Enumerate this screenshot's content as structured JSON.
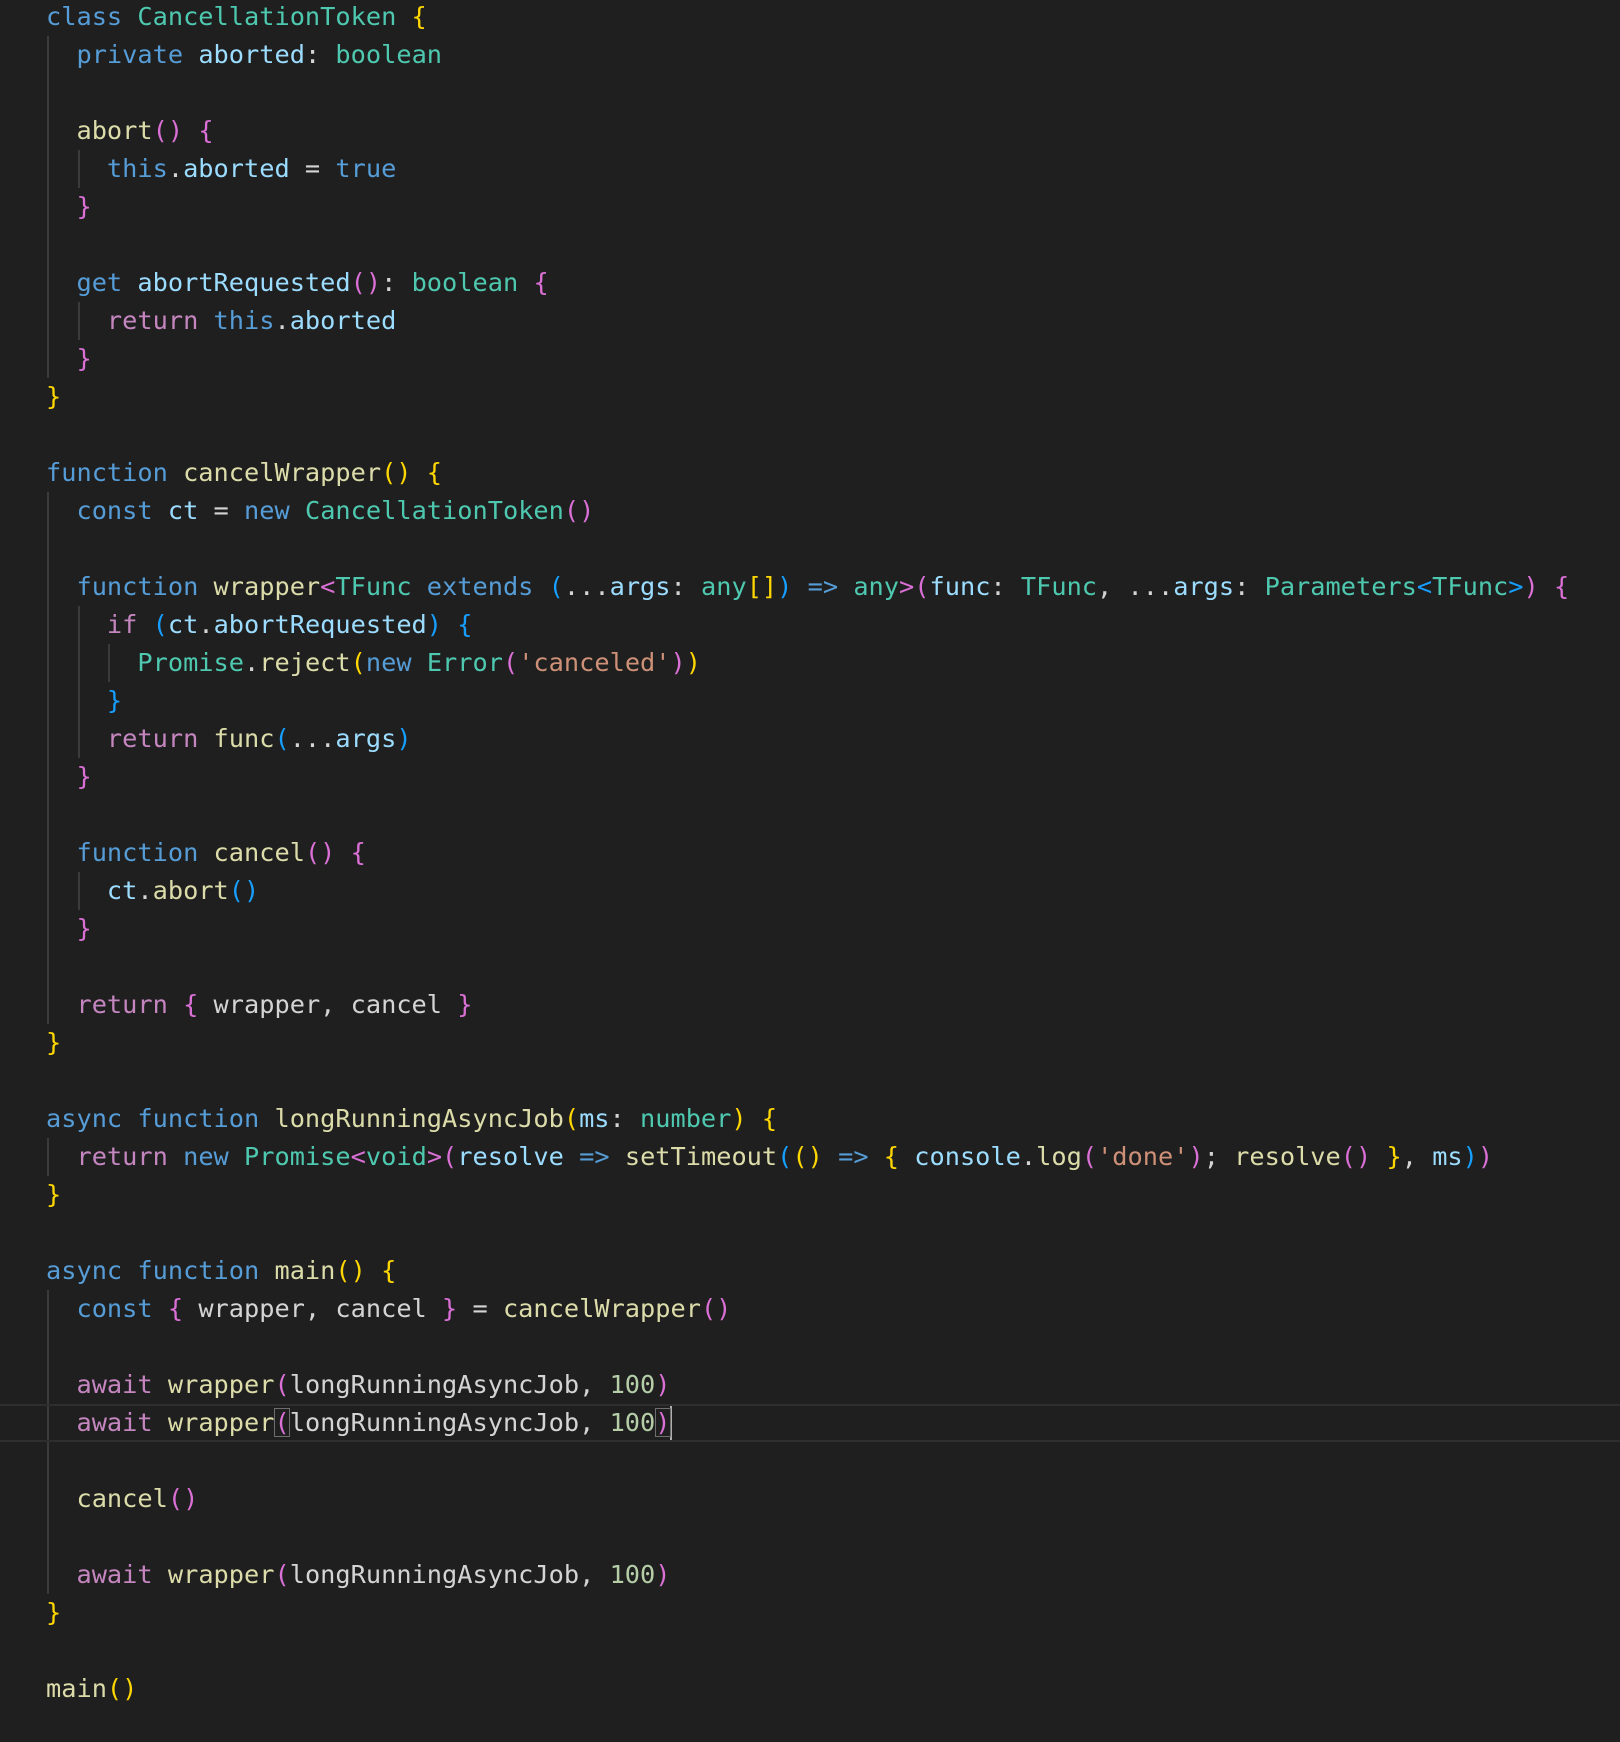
{
  "editor": {
    "language": "typescript",
    "theme_colors": {
      "background": "#1f1f1f",
      "keyword": "#569cd6",
      "control": "#c586c0",
      "type": "#4ec9b0",
      "function": "#dcdcaa",
      "variable": "#9cdcfe",
      "string": "#ce9178",
      "number": "#b5cea8",
      "bracket_level_1": "#ffd700",
      "bracket_level_2": "#da70d6",
      "bracket_level_3": "#179fff"
    },
    "cursor_line": 37,
    "lines": [
      [
        [
          "kw",
          "class"
        ],
        [
          "op",
          " "
        ],
        [
          "ty",
          "CancellationToken"
        ],
        [
          "op",
          " "
        ],
        [
          "b1",
          "{"
        ]
      ],
      [
        [
          "op",
          "  "
        ],
        [
          "kw",
          "private"
        ],
        [
          "op",
          " "
        ],
        [
          "var",
          "aborted"
        ],
        [
          "op",
          ": "
        ],
        [
          "ty",
          "boolean"
        ]
      ],
      [],
      [
        [
          "op",
          "  "
        ],
        [
          "fn",
          "abort"
        ],
        [
          "b2",
          "()"
        ],
        [
          "op",
          " "
        ],
        [
          "b2",
          "{"
        ]
      ],
      [
        [
          "op",
          "    "
        ],
        [
          "kw",
          "this"
        ],
        [
          "op",
          "."
        ],
        [
          "var",
          "aborted"
        ],
        [
          "op",
          " = "
        ],
        [
          "kw",
          "true"
        ]
      ],
      [
        [
          "op",
          "  "
        ],
        [
          "b2",
          "}"
        ]
      ],
      [],
      [
        [
          "op",
          "  "
        ],
        [
          "kw",
          "get"
        ],
        [
          "op",
          " "
        ],
        [
          "var",
          "abortRequested"
        ],
        [
          "b2",
          "()"
        ],
        [
          "op",
          ": "
        ],
        [
          "ty",
          "boolean"
        ],
        [
          "op",
          " "
        ],
        [
          "b2",
          "{"
        ]
      ],
      [
        [
          "op",
          "    "
        ],
        [
          "ctl",
          "return"
        ],
        [
          "op",
          " "
        ],
        [
          "kw",
          "this"
        ],
        [
          "op",
          "."
        ],
        [
          "var",
          "aborted"
        ]
      ],
      [
        [
          "op",
          "  "
        ],
        [
          "b2",
          "}"
        ]
      ],
      [
        [
          "b1",
          "}"
        ]
      ],
      [],
      [
        [
          "kw",
          "function"
        ],
        [
          "op",
          " "
        ],
        [
          "fn",
          "cancelWrapper"
        ],
        [
          "b1",
          "()"
        ],
        [
          "op",
          " "
        ],
        [
          "b1",
          "{"
        ]
      ],
      [
        [
          "op",
          "  "
        ],
        [
          "kw",
          "const"
        ],
        [
          "op",
          " "
        ],
        [
          "var",
          "ct"
        ],
        [
          "op",
          " = "
        ],
        [
          "kw",
          "new"
        ],
        [
          "op",
          " "
        ],
        [
          "ty",
          "CancellationToken"
        ],
        [
          "b2",
          "()"
        ]
      ],
      [],
      [
        [
          "op",
          "  "
        ],
        [
          "kw",
          "function"
        ],
        [
          "op",
          " "
        ],
        [
          "fn",
          "wrapper"
        ],
        [
          "b2",
          "<"
        ],
        [
          "ty",
          "TFunc"
        ],
        [
          "op",
          " "
        ],
        [
          "kw",
          "extends"
        ],
        [
          "op",
          " "
        ],
        [
          "b3",
          "("
        ],
        [
          "op",
          "..."
        ],
        [
          "var",
          "args"
        ],
        [
          "op",
          ": "
        ],
        [
          "ty",
          "any"
        ],
        [
          "b1",
          "[]"
        ],
        [
          "b3",
          ")"
        ],
        [
          "op",
          " "
        ],
        [
          "kw",
          "=>"
        ],
        [
          "op",
          " "
        ],
        [
          "ty",
          "any"
        ],
        [
          "b2",
          ">"
        ],
        [
          "b2",
          "("
        ],
        [
          "var",
          "func"
        ],
        [
          "op",
          ": "
        ],
        [
          "ty",
          "TFunc"
        ],
        [
          "op",
          ", ..."
        ],
        [
          "var",
          "args"
        ],
        [
          "op",
          ": "
        ],
        [
          "ty",
          "Parameters"
        ],
        [
          "b3",
          "<"
        ],
        [
          "ty",
          "TFunc"
        ],
        [
          "b3",
          ">"
        ],
        [
          "b2",
          ")"
        ],
        [
          "op",
          " "
        ],
        [
          "b2",
          "{"
        ]
      ],
      [
        [
          "op",
          "    "
        ],
        [
          "ctl",
          "if"
        ],
        [
          "op",
          " "
        ],
        [
          "b3",
          "("
        ],
        [
          "var",
          "ct"
        ],
        [
          "op",
          "."
        ],
        [
          "var",
          "abortRequested"
        ],
        [
          "b3",
          ")"
        ],
        [
          "op",
          " "
        ],
        [
          "b3",
          "{"
        ]
      ],
      [
        [
          "op",
          "      "
        ],
        [
          "ty",
          "Promise"
        ],
        [
          "op",
          "."
        ],
        [
          "fn",
          "reject"
        ],
        [
          "b1",
          "("
        ],
        [
          "kw",
          "new"
        ],
        [
          "op",
          " "
        ],
        [
          "ty",
          "Error"
        ],
        [
          "b2",
          "("
        ],
        [
          "str",
          "'canceled'"
        ],
        [
          "b2",
          ")"
        ],
        [
          "b1",
          ")"
        ]
      ],
      [
        [
          "op",
          "    "
        ],
        [
          "b3",
          "}"
        ]
      ],
      [
        [
          "op",
          "    "
        ],
        [
          "ctl",
          "return"
        ],
        [
          "op",
          " "
        ],
        [
          "fn",
          "func"
        ],
        [
          "b3",
          "("
        ],
        [
          "op",
          "..."
        ],
        [
          "var",
          "args"
        ],
        [
          "b3",
          ")"
        ]
      ],
      [
        [
          "op",
          "  "
        ],
        [
          "b2",
          "}"
        ]
      ],
      [],
      [
        [
          "op",
          "  "
        ],
        [
          "kw",
          "function"
        ],
        [
          "op",
          " "
        ],
        [
          "fn",
          "cancel"
        ],
        [
          "b2",
          "()"
        ],
        [
          "op",
          " "
        ],
        [
          "b2",
          "{"
        ]
      ],
      [
        [
          "op",
          "    "
        ],
        [
          "var",
          "ct"
        ],
        [
          "op",
          "."
        ],
        [
          "fn",
          "abort"
        ],
        [
          "b3",
          "()"
        ]
      ],
      [
        [
          "op",
          "  "
        ],
        [
          "b2",
          "}"
        ]
      ],
      [],
      [
        [
          "op",
          "  "
        ],
        [
          "ctl",
          "return"
        ],
        [
          "op",
          " "
        ],
        [
          "b2",
          "{"
        ],
        [
          "op",
          " wrapper, cancel "
        ],
        [
          "b2",
          "}"
        ]
      ],
      [
        [
          "b1",
          "}"
        ]
      ],
      [],
      [
        [
          "kw",
          "async"
        ],
        [
          "op",
          " "
        ],
        [
          "kw",
          "function"
        ],
        [
          "op",
          " "
        ],
        [
          "fn",
          "longRunningAsyncJob"
        ],
        [
          "b1",
          "("
        ],
        [
          "var",
          "ms"
        ],
        [
          "op",
          ": "
        ],
        [
          "ty",
          "number"
        ],
        [
          "b1",
          ")"
        ],
        [
          "op",
          " "
        ],
        [
          "b1",
          "{"
        ]
      ],
      [
        [
          "op",
          "  "
        ],
        [
          "ctl",
          "return"
        ],
        [
          "op",
          " "
        ],
        [
          "kw",
          "new"
        ],
        [
          "op",
          " "
        ],
        [
          "ty",
          "Promise"
        ],
        [
          "b2",
          "<"
        ],
        [
          "ty",
          "void"
        ],
        [
          "b2",
          ">"
        ],
        [
          "b2",
          "("
        ],
        [
          "var",
          "resolve"
        ],
        [
          "op",
          " "
        ],
        [
          "kw",
          "=>"
        ],
        [
          "op",
          " "
        ],
        [
          "fn",
          "setTimeout"
        ],
        [
          "b3",
          "("
        ],
        [
          "b1",
          "()"
        ],
        [
          "op",
          " "
        ],
        [
          "kw",
          "=>"
        ],
        [
          "op",
          " "
        ],
        [
          "b1",
          "{"
        ],
        [
          "op",
          " "
        ],
        [
          "var",
          "console"
        ],
        [
          "op",
          "."
        ],
        [
          "fn",
          "log"
        ],
        [
          "b2",
          "("
        ],
        [
          "str",
          "'done'"
        ],
        [
          "b2",
          ")"
        ],
        [
          "op",
          "; "
        ],
        [
          "fn",
          "resolve"
        ],
        [
          "b2",
          "()"
        ],
        [
          "op",
          " "
        ],
        [
          "b1",
          "}"
        ],
        [
          "op",
          ", "
        ],
        [
          "var",
          "ms"
        ],
        [
          "b3",
          ")"
        ],
        [
          "b2",
          ")"
        ]
      ],
      [
        [
          "b1",
          "}"
        ]
      ],
      [],
      [
        [
          "kw",
          "async"
        ],
        [
          "op",
          " "
        ],
        [
          "kw",
          "function"
        ],
        [
          "op",
          " "
        ],
        [
          "fn",
          "main"
        ],
        [
          "b1",
          "()"
        ],
        [
          "op",
          " "
        ],
        [
          "b1",
          "{"
        ]
      ],
      [
        [
          "op",
          "  "
        ],
        [
          "kw",
          "const"
        ],
        [
          "op",
          " "
        ],
        [
          "b2",
          "{"
        ],
        [
          "op",
          " wrapper, cancel "
        ],
        [
          "b2",
          "}"
        ],
        [
          "op",
          " = "
        ],
        [
          "fn",
          "cancelWrapper"
        ],
        [
          "b2",
          "()"
        ]
      ],
      [],
      [
        [
          "op",
          "  "
        ],
        [
          "ctl",
          "await"
        ],
        [
          "op",
          " "
        ],
        [
          "fn",
          "wrapper"
        ],
        [
          "b2",
          "("
        ],
        [
          "op",
          "longRunningAsyncJob, "
        ],
        [
          "num",
          "100"
        ],
        [
          "b2",
          ")"
        ]
      ],
      [
        [
          "op",
          "  "
        ],
        [
          "ctl",
          "await"
        ],
        [
          "op",
          " "
        ],
        [
          "fn",
          "wrapper"
        ],
        [
          "b2",
          "("
        ],
        [
          "op",
          "longRunningAsyncJob, "
        ],
        [
          "num",
          "100"
        ],
        [
          "b2",
          ")"
        ]
      ],
      [],
      [
        [
          "op",
          "  "
        ],
        [
          "fn",
          "cancel"
        ],
        [
          "b2",
          "()"
        ]
      ],
      [],
      [
        [
          "op",
          "  "
        ],
        [
          "ctl",
          "await"
        ],
        [
          "op",
          " "
        ],
        [
          "fn",
          "wrapper"
        ],
        [
          "b2",
          "("
        ],
        [
          "op",
          "longRunningAsyncJob, "
        ],
        [
          "num",
          "100"
        ],
        [
          "b2",
          ")"
        ]
      ],
      [
        [
          "b1",
          "}"
        ]
      ],
      [],
      [
        [
          "fn",
          "main"
        ],
        [
          "b1",
          "()"
        ]
      ]
    ]
  }
}
